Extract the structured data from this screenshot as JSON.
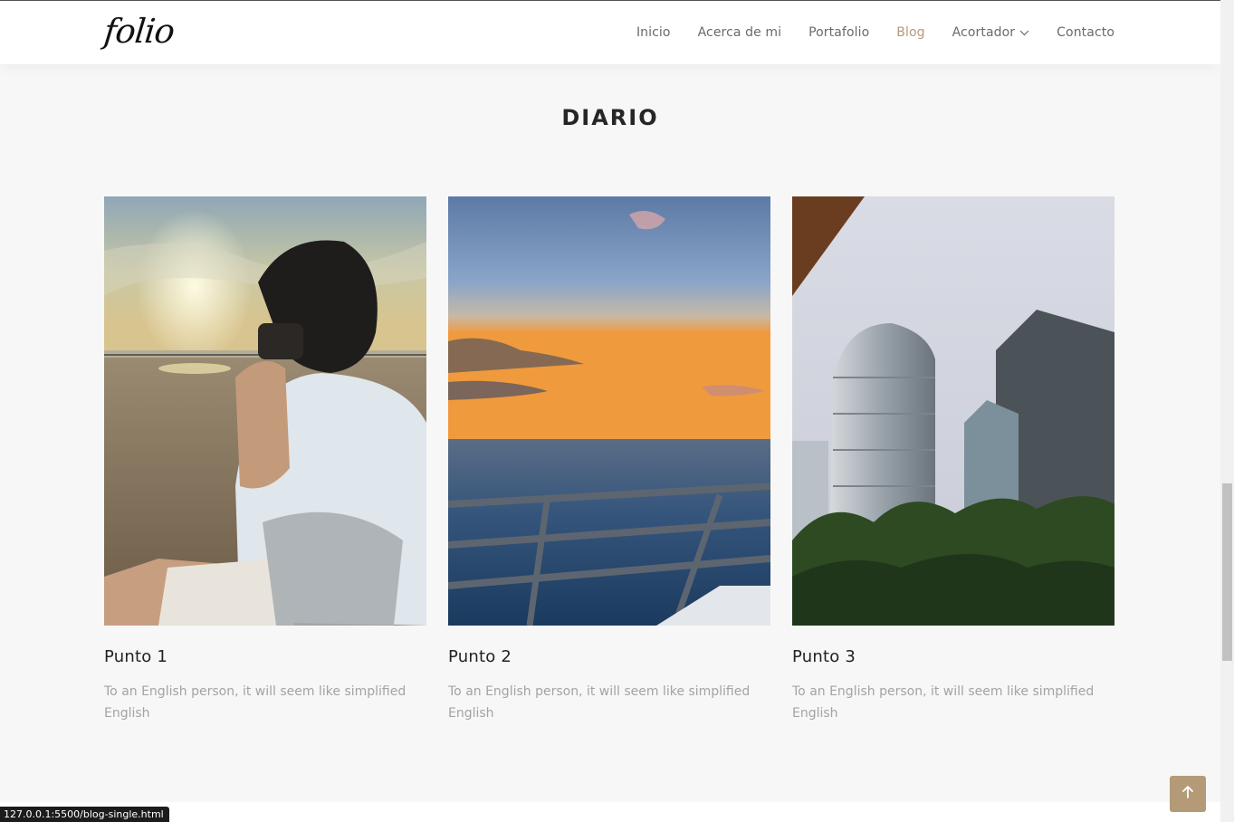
{
  "brand": {
    "logo": "folio"
  },
  "nav": {
    "items": [
      {
        "label": "Inicio"
      },
      {
        "label": "Acerca de mi"
      },
      {
        "label": "Portafolio"
      },
      {
        "label": "Blog"
      },
      {
        "label": "Acortador"
      },
      {
        "label": "Contacto"
      }
    ],
    "active": "Blog"
  },
  "section": {
    "title": "DIARIO"
  },
  "posts": [
    {
      "title": "Punto 1",
      "excerpt": "To an English person, it will seem like simplified English",
      "image": "beach-photographer-photo"
    },
    {
      "title": "Punto 2",
      "excerpt": "To an English person, it will seem like simplified English",
      "image": "sea-sunset-photo"
    },
    {
      "title": "Punto 3",
      "excerpt": "To an English person, it will seem like simplified English",
      "image": "skyscrapers-photo"
    }
  ],
  "status_bar": {
    "url": "127.0.0.1:5500/blog-single.html"
  },
  "icons": {
    "back_to_top": "arrow-up-icon",
    "dropdown": "chevron-down-icon"
  },
  "colors": {
    "accent": "#b49a77",
    "nav_text": "#6a6a6a",
    "excerpt_text": "#a3a3a3",
    "background": "#f7f7f7"
  }
}
